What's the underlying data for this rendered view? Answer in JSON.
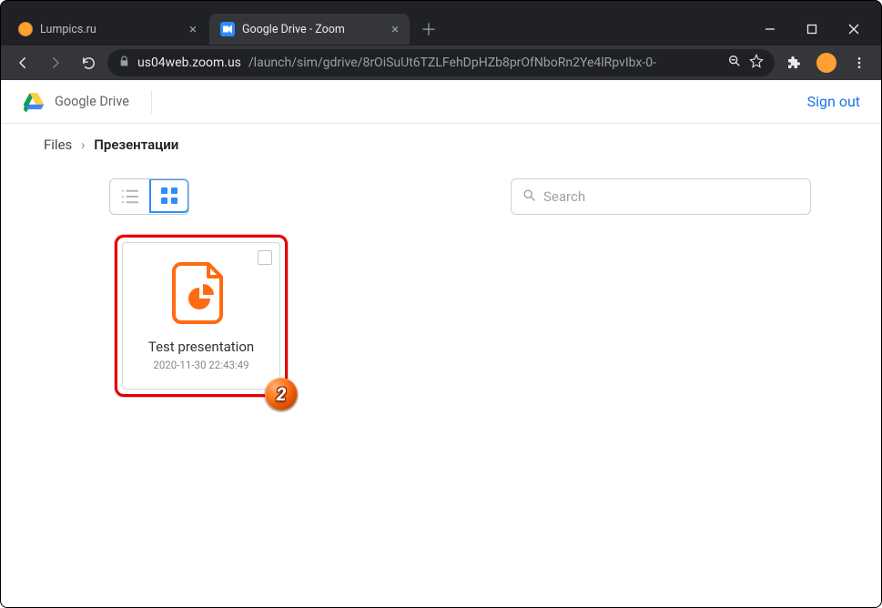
{
  "browser": {
    "tabs": [
      {
        "label": "Lumpics.ru",
        "active": false,
        "favicon": "orange"
      },
      {
        "label": "Google Drive - Zoom",
        "active": true,
        "favicon": "zoom"
      }
    ],
    "url_domain": "us04web.zoom.us",
    "url_path": "/launch/sim/gdrive/8rOiSuUt6TZLFehDpHZb8prOfNboRn2Ye4lRpvIbx-0-"
  },
  "header": {
    "service": "Google Drive",
    "signout": "Sign out"
  },
  "breadcrumb": {
    "root": "Files",
    "current": "Презентации"
  },
  "toolbar": {
    "view": "grid",
    "search_placeholder": "Search"
  },
  "files": [
    {
      "name": "Test presentation",
      "date": "2020-11-30 22:43:49",
      "type": "slides",
      "checked": false
    }
  ],
  "annotation": {
    "step": "2"
  },
  "colors": {
    "accent_blue": "#2d8cff",
    "accent_orange": "#ff6a13",
    "highlight_red": "#e30000"
  }
}
